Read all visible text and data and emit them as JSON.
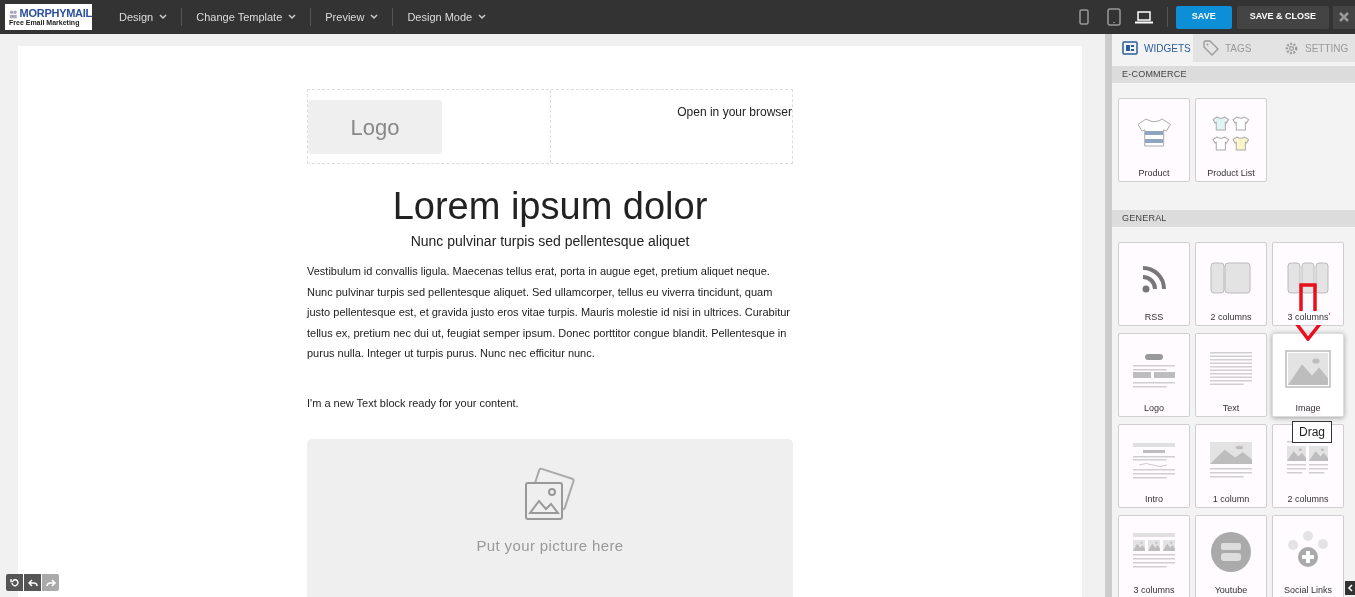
{
  "brand": {
    "name": "MORPHYMAIL",
    "tagline": "Free Email Marketing"
  },
  "menu": [
    {
      "label": "Design"
    },
    {
      "label": "Change Template"
    },
    {
      "label": "Preview"
    },
    {
      "label": "Design Mode"
    }
  ],
  "devices": [
    {
      "kind": "mobile",
      "selected": false
    },
    {
      "kind": "tablet",
      "selected": false
    },
    {
      "kind": "laptop",
      "selected": true
    }
  ],
  "actions": {
    "save": "SAVE",
    "save_close": "SAVE & CLOSE"
  },
  "email": {
    "logo": "Logo",
    "browser_link": "Open in your browser",
    "title": "Lorem ipsum dolor",
    "subtitle": "Nunc pulvinar turpis sed pellentesque aliquet",
    "body": "Vestibulum id convallis ligula. Maecenas tellus erat, porta in augue eget, pretium aliquet neque. Nunc pulvinar turpis sed pellentesque aliquet. Sed ullamcorper, tellus eu viverra tincidunt, quam justo pellentesque est, et gravida justo eros vitae turpis. Mauris molestie id nisi in ultrices. Curabitur tellus ex, pretium nec dui ut, feugiat semper ipsum. Donec porttitor congue blandit. Pellentesque in purus nulla. Integer ut turpis purus. Nunc nec efficitur nunc.",
    "text_block": "I'm a new Text block ready for your content.",
    "picture_hint": "Put your picture here"
  },
  "tabs": [
    {
      "label": "WIDGETS",
      "kind": "widgets",
      "selected": true
    },
    {
      "label": "TAGS",
      "kind": "tags",
      "selected": false
    },
    {
      "label": "SETTING",
      "kind": "setting",
      "selected": false
    }
  ],
  "sections": [
    {
      "title": "E-COMMERCE",
      "widgets": [
        {
          "label": "Product",
          "kind": "product",
          "selected": false
        },
        {
          "label": "Product List",
          "kind": "product-list",
          "selected": false
        }
      ]
    },
    {
      "title": "GENERAL",
      "widgets": [
        {
          "label": "RSS",
          "kind": "rss",
          "selected": false
        },
        {
          "label": "2 columns",
          "kind": "two-panels",
          "selected": false
        },
        {
          "label": "3 columns",
          "kind": "three-panels",
          "selected": false
        },
        {
          "label": "Logo",
          "kind": "logo",
          "selected": false
        },
        {
          "label": "Text",
          "kind": "text",
          "selected": false
        },
        {
          "label": "Image",
          "kind": "image",
          "selected": true
        },
        {
          "label": "Intro",
          "kind": "intro",
          "selected": false
        },
        {
          "label": "1 column",
          "kind": "one-column",
          "selected": false
        },
        {
          "label": "2 columns",
          "kind": "two-columns",
          "selected": false
        },
        {
          "label": "3 columns",
          "kind": "three-columns",
          "selected": false
        },
        {
          "label": "Youtube",
          "kind": "youtube",
          "selected": false
        },
        {
          "label": "Social Links",
          "kind": "social",
          "selected": false
        }
      ]
    }
  ],
  "tooltip": "Drag"
}
